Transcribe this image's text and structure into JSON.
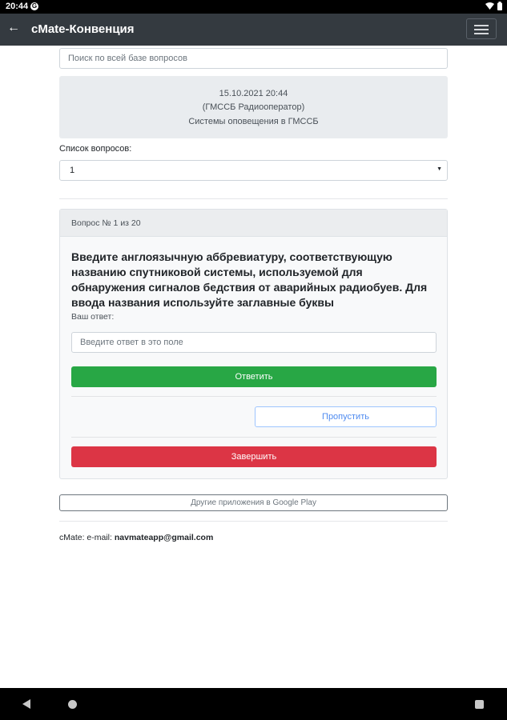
{
  "status_bar": {
    "time": "20:44",
    "g_glyph": "G",
    "wifi_glyph": "▼",
    "battery_glyph": "▮"
  },
  "app_bar": {
    "back_glyph": "←",
    "title": "cMate-Конвенция",
    "menu_icon": "hamburger-icon"
  },
  "search": {
    "placeholder": "Поиск по всей базе вопросов"
  },
  "info": {
    "date": "15.10.2021 20:44",
    "course": "(ГМССБ Радиооператор)",
    "topic": "Системы оповещения в ГМССБ"
  },
  "question_list": {
    "label": "Список вопросов:",
    "selected": "1",
    "caret": "▼"
  },
  "question_card": {
    "header": "Вопрос № 1 из 20",
    "text": "Введите англоязычную аббревиатуру, соответствующую названию спутниковой системы, используемой для обнаружения сигналов бедствия от аварийных радиобуев. Для ввода названия используйте заглавные буквы",
    "answer_label": "Ваш ответ:",
    "answer_placeholder": "Введите ответ в это поле",
    "answer_button": "Ответить",
    "skip_button": "Пропустить",
    "finish_button": "Завершить"
  },
  "other_apps": "Другие приложения в Google Play",
  "footer": {
    "prefix": "cMate: e-mail: ",
    "email": "navmateapp@gmail.com"
  },
  "colors": {
    "appbar": "#343a40",
    "success": "#28a745",
    "danger": "#dc3545",
    "primary_outline": "#4f8bf0"
  }
}
